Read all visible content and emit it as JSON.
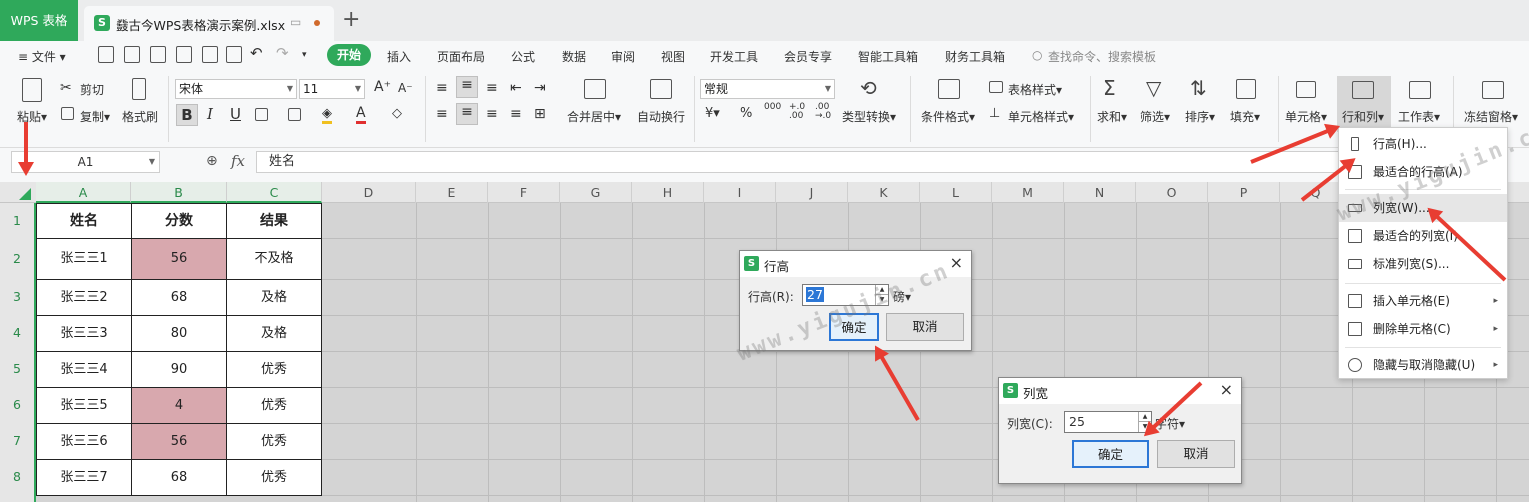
{
  "titlebar": {
    "app_tab": "WPS 表格",
    "doc_tab": "鼗古今WPS表格演示案例.xlsx",
    "new_tab": "+"
  },
  "menubar": {
    "file": "≡ 文件 ▾",
    "start": "开始",
    "items": [
      "插入",
      "页面布局",
      "公式",
      "数据",
      "审阅",
      "视图",
      "开发工具",
      "会员专享",
      "智能工具箱",
      "财务工具箱"
    ],
    "search": "查找命令、搜索模板"
  },
  "ribbon": {
    "paste": "粘贴▾",
    "cut": "剪切",
    "copy": "复制▾",
    "format_painter": "格式刷",
    "font": "宋体",
    "size": "11",
    "bold": "B",
    "italic": "I",
    "underline": "U",
    "merge": "合并居中▾",
    "wrap": "自动换行",
    "number_format": "常规",
    "currency": "¥▾",
    "percent": "%",
    "type_convert": "类型转换▾",
    "cond_format": "条件格式▾",
    "table_style": "表格样式▾",
    "cell_style": "单元格样式▾",
    "sum": "求和▾",
    "filter": "筛选▾",
    "sort": "排序▾",
    "fill": "填充▾",
    "cell": "单元格▾",
    "rowcol": "行和列▾",
    "sheet": "工作表▾",
    "freeze": "冻结窗格▾"
  },
  "formula": {
    "cell_ref": "A1",
    "fx": "fx",
    "value": "姓名"
  },
  "columns": [
    "A",
    "B",
    "C",
    "D",
    "E",
    "F",
    "G",
    "H",
    "I",
    "J",
    "K",
    "L",
    "M",
    "N",
    "O",
    "P",
    "Q"
  ],
  "rows": [
    "1",
    "2",
    "3",
    "4",
    "5",
    "6",
    "7",
    "8"
  ],
  "table": {
    "headers": [
      "姓名",
      "分数",
      "结果"
    ],
    "rows": [
      [
        "张三三1",
        "56",
        "不及格"
      ],
      [
        "张三三2",
        "68",
        "及格"
      ],
      [
        "张三三3",
        "80",
        "及格"
      ],
      [
        "张三三4",
        "90",
        "优秀"
      ],
      [
        "张三三5",
        "4",
        "优秀"
      ],
      [
        "张三三6",
        "56",
        "优秀"
      ],
      [
        "张三三7",
        "68",
        "优秀"
      ]
    ]
  },
  "dialog_row": {
    "title": "行高",
    "label": "行高(R):",
    "value": "27",
    "unit": "磅▾",
    "ok": "确定",
    "cancel": "取消"
  },
  "dialog_col": {
    "title": "列宽",
    "label": "列宽(C):",
    "value": "25",
    "unit": "字符▾",
    "ok": "确定",
    "cancel": "取消"
  },
  "context_menu": {
    "items": [
      "行高(H)...",
      "最适合的行高(A)",
      "列宽(W)...",
      "最适合的列宽(I)",
      "标准列宽(S)...",
      "插入单元格(E)",
      "删除单元格(C)",
      "隐藏与取消隐藏(U)"
    ]
  },
  "watermark": "www.yigujin.cn",
  "colors": {
    "brand": "#2fa95b",
    "arrow": "#e83d32",
    "low_score": "#d8a8ae"
  }
}
